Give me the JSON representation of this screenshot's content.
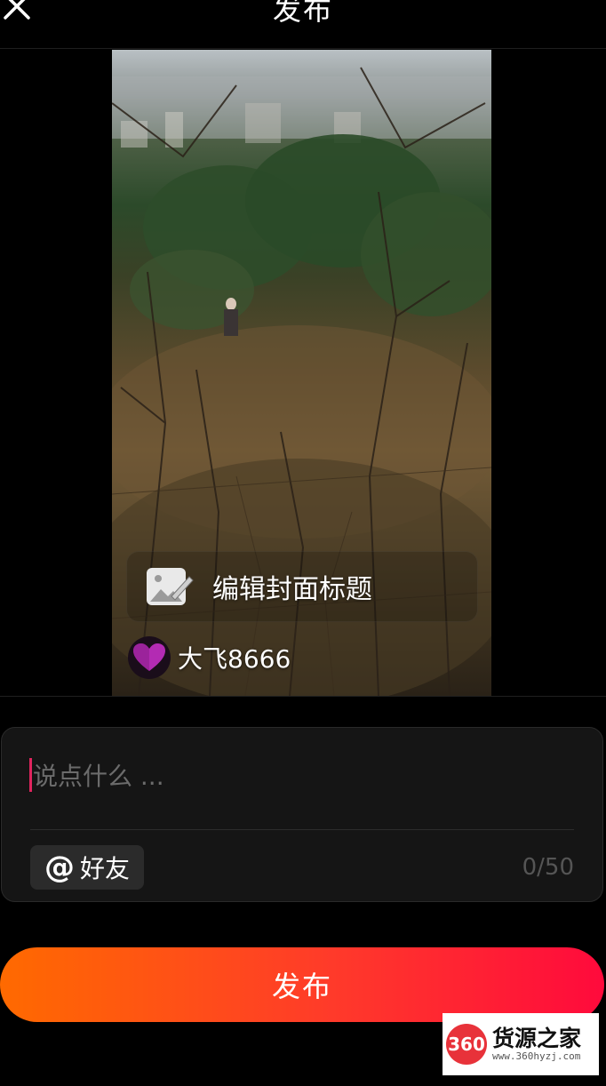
{
  "header": {
    "title": "发布",
    "close_icon": "close-icon"
  },
  "media": {
    "cover_title_label": "编辑封面标题",
    "cover_edit_icon": "image-edit-icon",
    "author_name": "大飞8666",
    "avatar_icon": "heart-avatar"
  },
  "composer": {
    "placeholder": "说点什么 ...",
    "value": "",
    "mention_symbol": "@",
    "mention_label": "好友",
    "char_count": "0/50"
  },
  "publish": {
    "label": "发布",
    "gradient_from": "#ff6a00",
    "gradient_to": "#ff0a3c"
  },
  "watermark": {
    "logo_text": "360",
    "name": "货源之家",
    "url": "www.360hyzj.com"
  },
  "colors": {
    "background": "#000000",
    "caret": "#e0245e",
    "panel": "#151515"
  }
}
